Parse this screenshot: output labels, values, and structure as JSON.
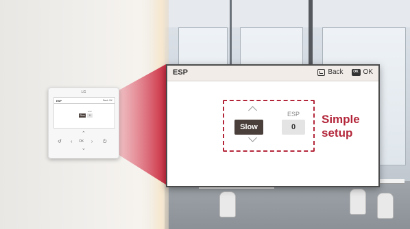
{
  "device": {
    "logo_label": "LG",
    "screen_title": "ESP",
    "screen_nav": "Back OK",
    "mode_value": "Slow",
    "esp_label": "ESP",
    "esp_value": "0",
    "keys": {
      "back_symbol": "↺",
      "left_symbol": "‹",
      "ok_label": "OK",
      "right_symbol": "›",
      "power_symbol": "⏻",
      "up_symbol": "⌃",
      "down_symbol": "⌄"
    }
  },
  "panel": {
    "title": "ESP",
    "back_label": "Back",
    "ok_label": "OK",
    "ok_icon_text": "OK",
    "mode_value": "Slow",
    "esp_label": "ESP",
    "esp_value": "0"
  },
  "annotation": {
    "line1": "Simple",
    "line2": "setup"
  },
  "colors": {
    "accent": "#b3263a",
    "selected_bg": "#4a3f3b",
    "value_bg": "#e4e4e4",
    "header_bg": "#f1ece8"
  },
  "icons": [
    "back-icon",
    "ok-icon",
    "chevron-up-icon",
    "chevron-down-icon",
    "power-icon"
  ]
}
